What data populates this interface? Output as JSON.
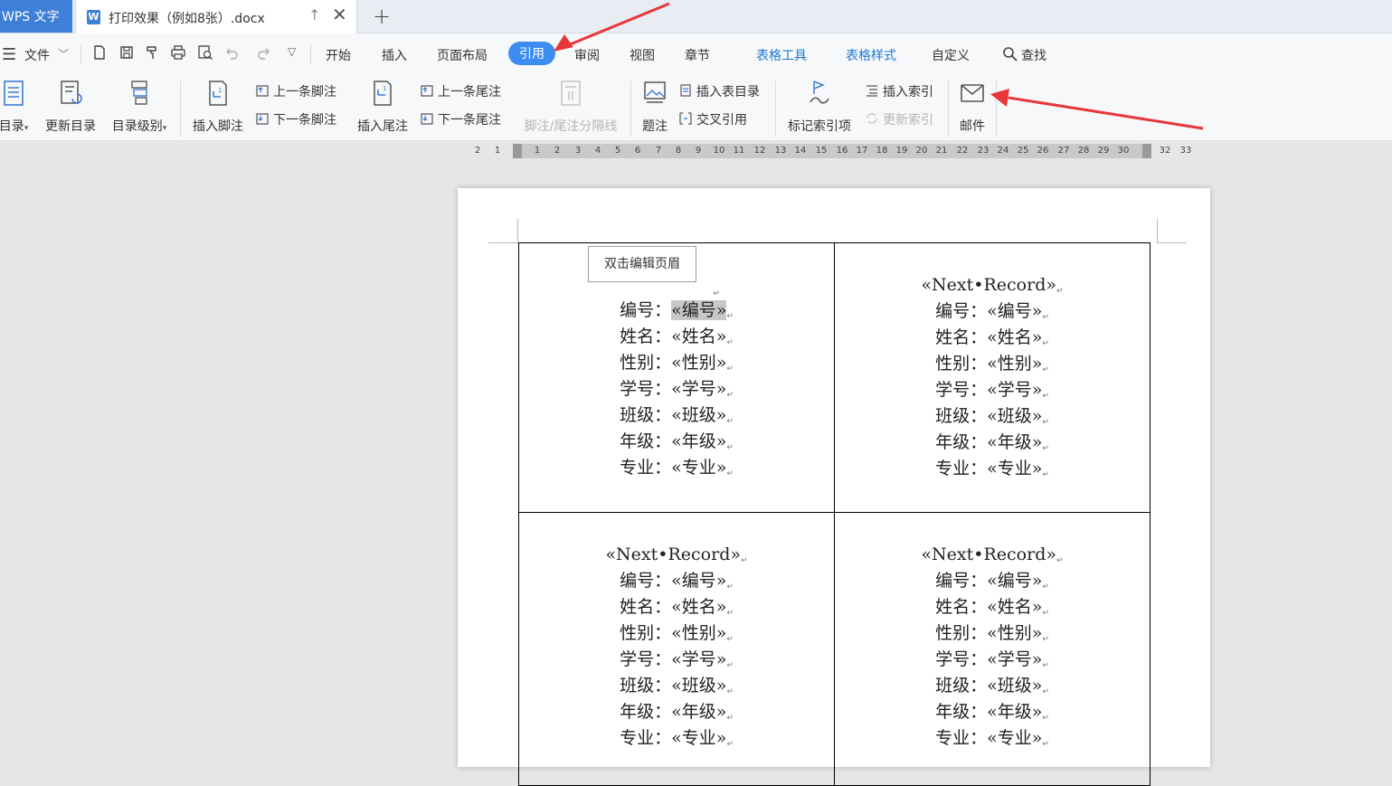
{
  "app_tab": "WPS 文字",
  "doc_tab": {
    "title": "打印效果（例如8张）.docx",
    "icon": "W"
  },
  "menu": {
    "file": "文件",
    "items": [
      "开始",
      "插入",
      "页面布局",
      "引用",
      "审阅",
      "视图",
      "章节",
      "表格工具",
      "表格样式",
      "自定义",
      "查找"
    ],
    "active": "引用"
  },
  "ribbon": {
    "toc": "目录",
    "update_toc": "更新目录",
    "toc_level": "目录级别",
    "insert_footnote": "插入脚注",
    "prev_footnote": "上一条脚注",
    "next_footnote": "下一条脚注",
    "insert_endnote": "插入尾注",
    "prev_endnote": "上一条尾注",
    "next_endnote": "下一条尾注",
    "separator": "脚注/尾注分隔线",
    "caption": "题注",
    "insert_toc_table": "插入表目录",
    "cross_ref": "交叉引用",
    "mark_index": "标记索引项",
    "insert_index": "插入索引",
    "update_index": "更新索引",
    "mail": "邮件"
  },
  "ruler": [
    "2",
    "1",
    "1",
    "2",
    "3",
    "4",
    "5",
    "6",
    "7",
    "8",
    "9",
    "10",
    "11",
    "12",
    "13",
    "14",
    "15",
    "16",
    "17",
    "18",
    "19",
    "20",
    "21",
    "22",
    "23",
    "24",
    "25",
    "26",
    "27",
    "28",
    "29",
    "30",
    "32",
    "33"
  ],
  "document": {
    "header_tip": "双击编辑页眉",
    "next_record": "«Next•Record»",
    "fields": [
      {
        "label": "编号：",
        "value": "«编号»"
      },
      {
        "label": "姓名：",
        "value": "«姓名»"
      },
      {
        "label": "性别：",
        "value": "«性别»"
      },
      {
        "label": "学号：",
        "value": "«学号»"
      },
      {
        "label": "班级：",
        "value": "«班级»"
      },
      {
        "label": "年级：",
        "value": "«年级»"
      },
      {
        "label": "专业：",
        "value": "«专业»"
      }
    ]
  },
  "colors": {
    "accent": "#3d8cf1",
    "app_tab": "#3e7fd9",
    "arrow": "#e8373a"
  }
}
